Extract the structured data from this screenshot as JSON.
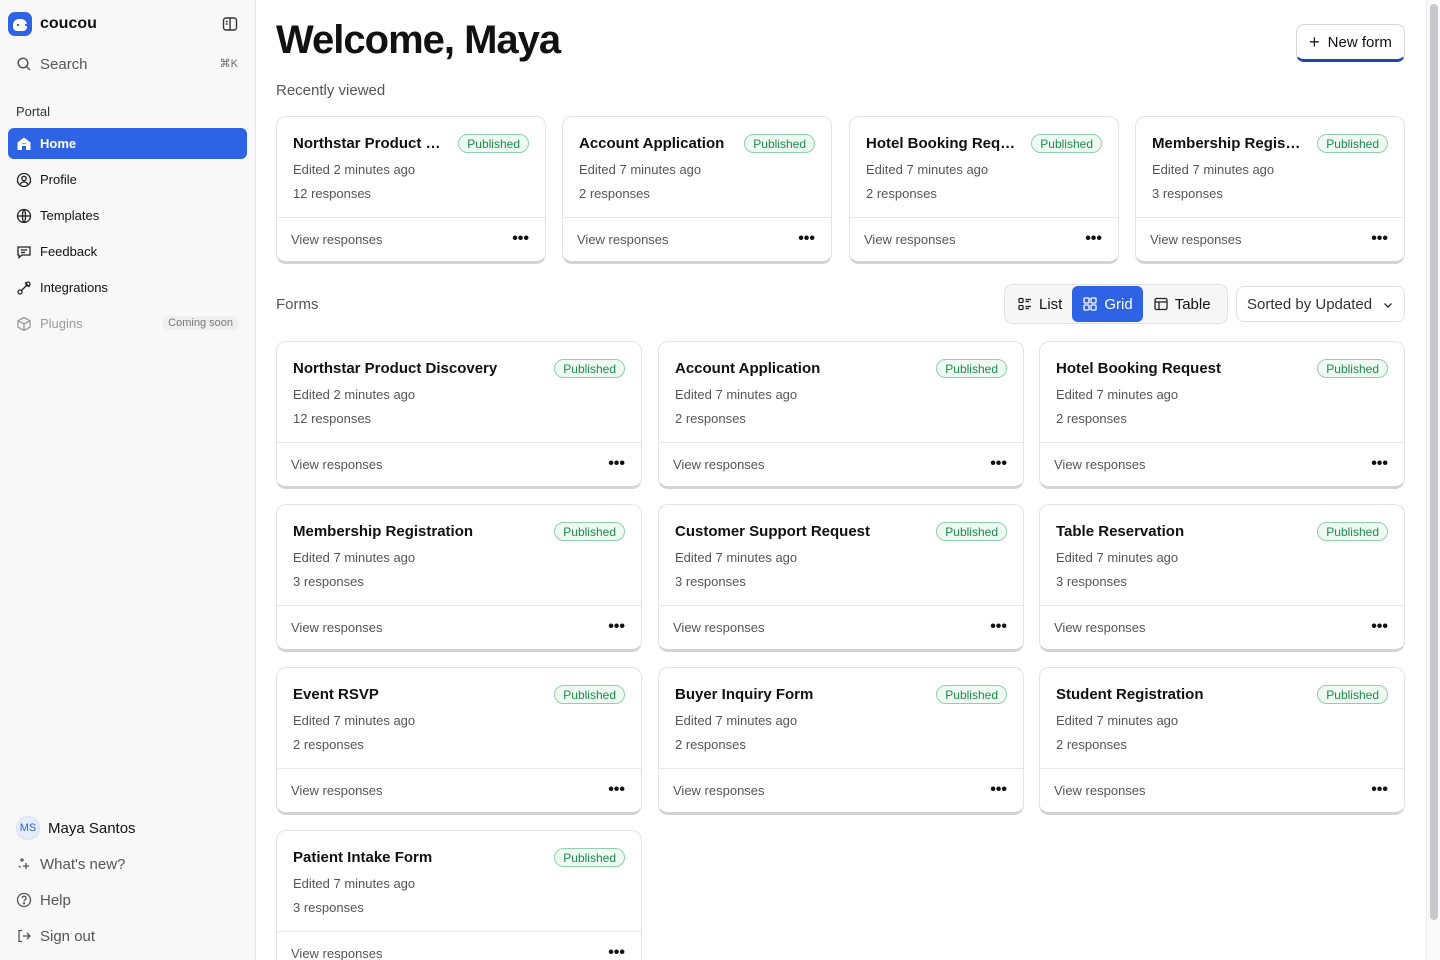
{
  "app": {
    "name": "coucou"
  },
  "search": {
    "label": "Search",
    "shortcut": "⌘K"
  },
  "sidebar": {
    "section": "Portal",
    "items": [
      {
        "label": "Home",
        "icon": "home-icon",
        "active": true
      },
      {
        "label": "Profile",
        "icon": "user-circle-icon"
      },
      {
        "label": "Templates",
        "icon": "globe-icon"
      },
      {
        "label": "Feedback",
        "icon": "chat-icon"
      },
      {
        "label": "Integrations",
        "icon": "plug-icon"
      },
      {
        "label": "Plugins",
        "icon": "cube-icon",
        "badge": "Coming soon",
        "disabled": true
      }
    ],
    "bottom": {
      "user_initials": "MS",
      "user_name": "Maya Santos",
      "whats_new": "What's new?",
      "help": "Help",
      "sign_out": "Sign out"
    }
  },
  "header": {
    "title": "Welcome, Maya",
    "new_form": "New form"
  },
  "recent": {
    "label": "Recently viewed",
    "cards": [
      {
        "title": "Northstar Product Discovery",
        "status": "Published",
        "edited": "Edited 2 minutes ago",
        "responses": "12 responses",
        "action": "View responses"
      },
      {
        "title": "Account Application",
        "status": "Published",
        "edited": "Edited 7 minutes ago",
        "responses": "2 responses",
        "action": "View responses"
      },
      {
        "title": "Hotel Booking Request",
        "status": "Published",
        "edited": "Edited 7 minutes ago",
        "responses": "2 responses",
        "action": "View responses"
      },
      {
        "title": "Membership Registration",
        "status": "Published",
        "edited": "Edited 7 minutes ago",
        "responses": "3 responses",
        "action": "View responses"
      }
    ]
  },
  "forms": {
    "label": "Forms",
    "views": {
      "list": "List",
      "grid": "Grid",
      "table": "Table",
      "active": "grid"
    },
    "sort": "Sorted by Updated",
    "cards": [
      {
        "title": "Northstar Product Discovery",
        "status": "Published",
        "edited": "Edited 2 minutes ago",
        "responses": "12 responses",
        "action": "View responses"
      },
      {
        "title": "Account Application",
        "status": "Published",
        "edited": "Edited 7 minutes ago",
        "responses": "2 responses",
        "action": "View responses"
      },
      {
        "title": "Hotel Booking Request",
        "status": "Published",
        "edited": "Edited 7 minutes ago",
        "responses": "2 responses",
        "action": "View responses"
      },
      {
        "title": "Membership Registration",
        "status": "Published",
        "edited": "Edited 7 minutes ago",
        "responses": "3 responses",
        "action": "View responses"
      },
      {
        "title": "Customer Support Request",
        "status": "Published",
        "edited": "Edited 7 minutes ago",
        "responses": "3 responses",
        "action": "View responses"
      },
      {
        "title": "Table Reservation",
        "status": "Published",
        "edited": "Edited 7 minutes ago",
        "responses": "3 responses",
        "action": "View responses"
      },
      {
        "title": "Event RSVP",
        "status": "Published",
        "edited": "Edited 7 minutes ago",
        "responses": "2 responses",
        "action": "View responses"
      },
      {
        "title": "Buyer Inquiry Form",
        "status": "Published",
        "edited": "Edited 7 minutes ago",
        "responses": "2 responses",
        "action": "View responses"
      },
      {
        "title": "Student Registration",
        "status": "Published",
        "edited": "Edited 7 minutes ago",
        "responses": "2 responses",
        "action": "View responses"
      },
      {
        "title": "Patient Intake Form",
        "status": "Published",
        "edited": "Edited 7 minutes ago",
        "responses": "3 responses",
        "action": "View responses"
      }
    ]
  },
  "colors": {
    "accent": "#2e63e6",
    "published_text": "#1f8a4e",
    "published_bg": "#edf9f1"
  }
}
